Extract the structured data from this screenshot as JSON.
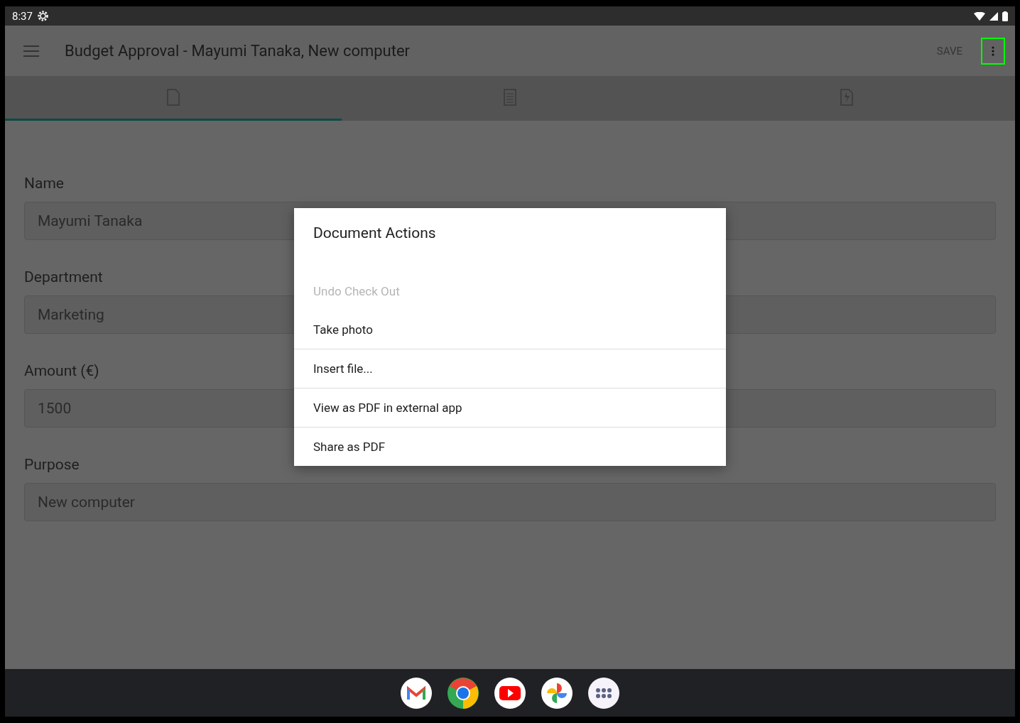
{
  "status_bar": {
    "time": "8:37"
  },
  "app_bar": {
    "title": "Budget Approval - Mayumi Tanaka, New computer",
    "save": "SAVE",
    "more_highlighted": true
  },
  "tabs": [
    {
      "kind": "document",
      "selected": true
    },
    {
      "kind": "form",
      "selected": false
    },
    {
      "kind": "attachment",
      "selected": false
    }
  ],
  "fields": [
    {
      "label": "Name",
      "value": "Mayumi Tanaka"
    },
    {
      "label": "Department",
      "value": "Marketing"
    },
    {
      "label": "Amount (€)",
      "value": "1500"
    },
    {
      "label": "Purpose",
      "value": "New computer"
    }
  ],
  "dialog": {
    "title": "Document Actions",
    "items": [
      {
        "label": "Undo Check Out",
        "disabled": true
      },
      {
        "label": "Take photo",
        "disabled": false
      },
      {
        "label": "Insert file...",
        "disabled": false
      },
      {
        "label": "View as PDF in external app",
        "disabled": false
      },
      {
        "label": "Share as PDF",
        "disabled": false
      }
    ]
  },
  "dock": [
    {
      "kind": "mail"
    },
    {
      "kind": "browser"
    },
    {
      "kind": "video"
    },
    {
      "kind": "photos"
    },
    {
      "kind": "apps"
    }
  ]
}
